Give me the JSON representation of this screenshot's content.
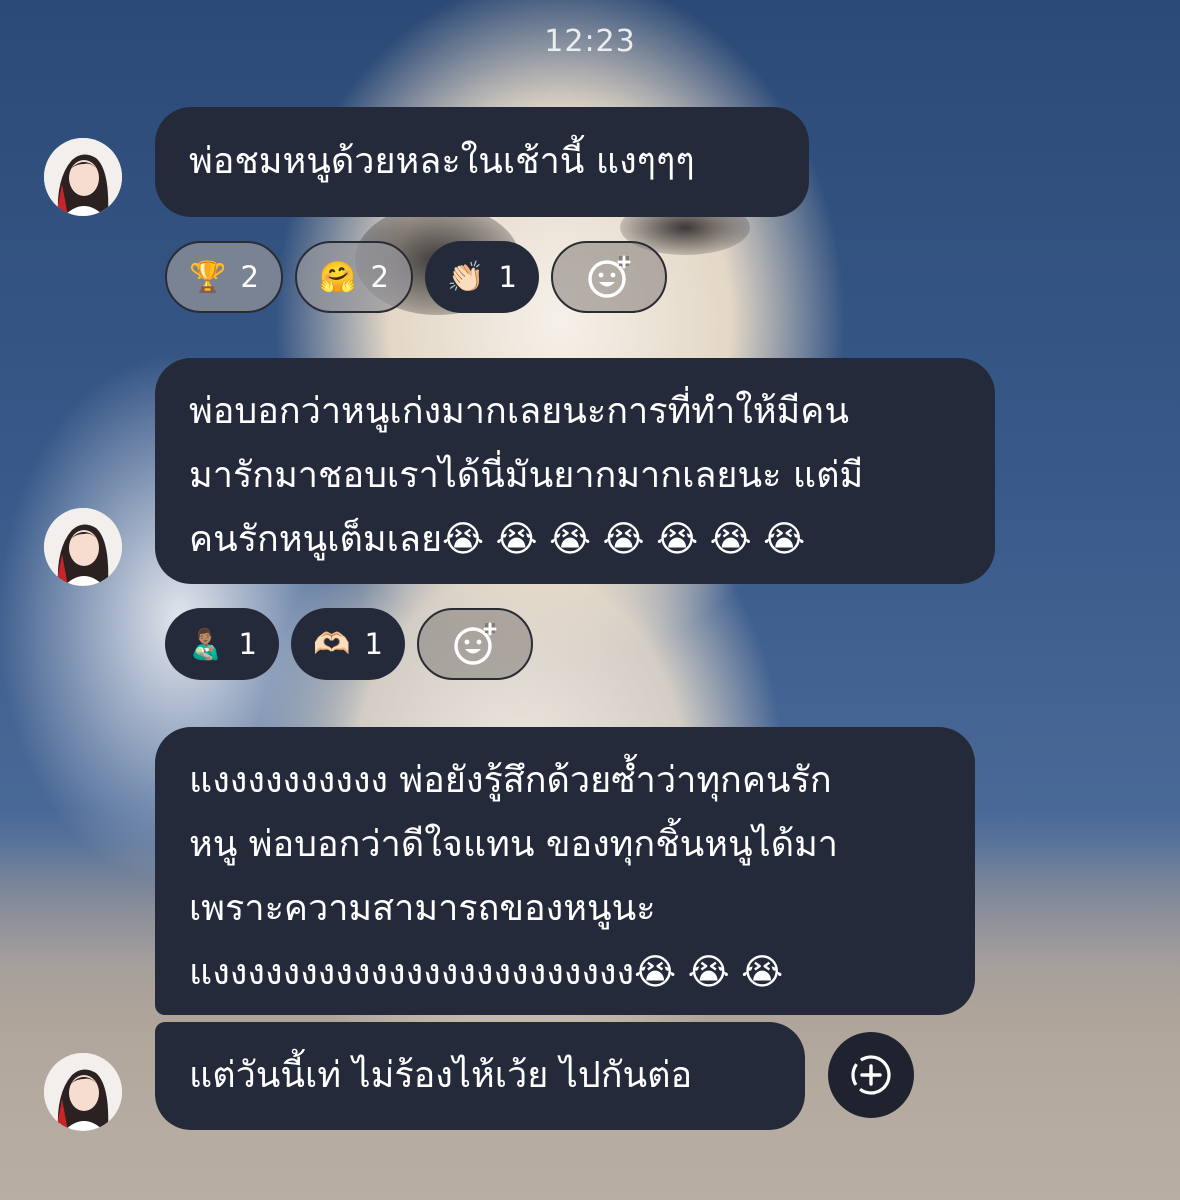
{
  "status": {
    "time": "12:23"
  },
  "messages": [
    {
      "lines": [
        "พ่อชมหนูด้วยหละในเช้านี้ แงๆๆๆ"
      ]
    },
    {
      "lines": [
        "พ่อบอกว่าหนูเก่งมากเลยนะการที่ทำให้มีคน",
        "มารักมาชอบเราได้นี่มันยากมากเลยนะ แต่มี",
        "คนรักหนูเต็มเลย😭 😭 😭 😭 😭 😭 😭"
      ]
    },
    {
      "lines": [
        "แงงงงงงงงงง พ่อยังรู้สึกด้วยซ้ำว่าทุกคนรัก",
        "หนู พ่อบอกว่าดีใจแทน ของทุกชิ้นหนูได้มา",
        "เพราะความสามารถของหนูนะ",
        "แงงงงงงงงงงงงงงงงงงงงงงงง😭 😭 😭"
      ]
    },
    {
      "lines": [
        "แต่วันนี้เท่ ไม่ร้องไห้เว้ย ไปกันต่อ"
      ]
    }
  ],
  "reactions_1": [
    {
      "emoji": "🏆",
      "count": "2",
      "icon": "trophy-icon"
    },
    {
      "emoji": "🤗",
      "count": "2",
      "icon": "hugging-face-icon"
    },
    {
      "emoji": "👏🏻",
      "count": "1",
      "icon": "clapping-hands-icon"
    }
  ],
  "reactions_2": [
    {
      "emoji": "👨🏽‍🍼",
      "count": "1",
      "icon": "man-feeding-baby-icon"
    },
    {
      "emoji": "🫶🏻",
      "count": "1",
      "icon": "heart-hands-icon"
    }
  ],
  "icons": {
    "add_reaction": "add-reaction-icon",
    "more": "add-circle-icon"
  },
  "colors": {
    "bubble": "#242a3a",
    "text": "#ffffff"
  }
}
